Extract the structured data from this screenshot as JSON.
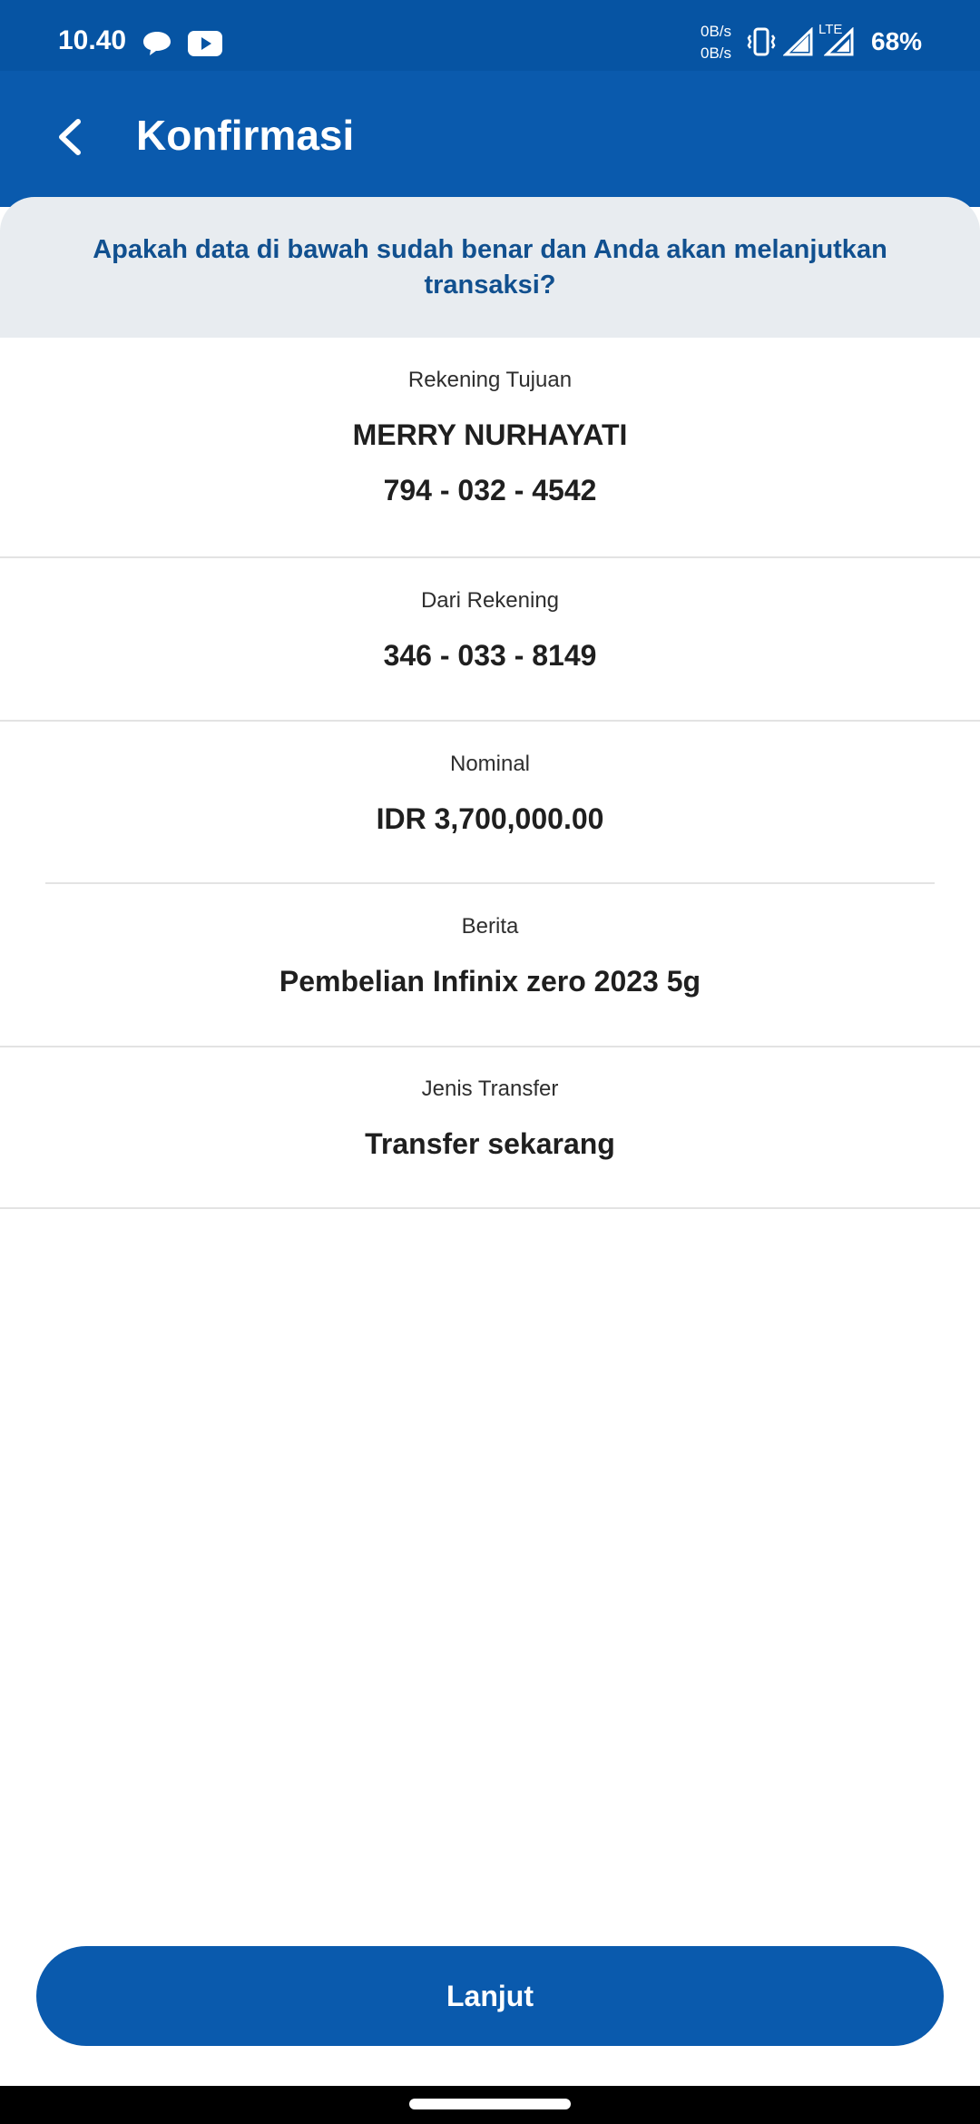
{
  "status_bar": {
    "time": "10.40",
    "net_speed_up": "0B/s",
    "net_speed_down": "0B/s",
    "network_type": "LTE",
    "battery": "68%",
    "icons": [
      "chat-bubble-icon",
      "youtube-icon",
      "vibrate-icon",
      "signal-icon",
      "signal-icon"
    ]
  },
  "header": {
    "title": "Konfirmasi",
    "back_icon": "chevron-left-icon"
  },
  "prompt": {
    "text": "Apakah data di bawah sudah benar dan Anda akan melanjutkan transaksi?"
  },
  "details": {
    "destination": {
      "label": "Rekening Tujuan",
      "name": "MERRY NURHAYATI",
      "account": "794 - 032 - 4542"
    },
    "source": {
      "label": "Dari Rekening",
      "account": "346 - 033 - 8149"
    },
    "amount": {
      "label": "Nominal",
      "value": "IDR 3,700,000.00"
    },
    "message": {
      "label": "Berita",
      "value": "Pembelian Infinix zero 2023 5g"
    },
    "transfer_type": {
      "label": "Jenis Transfer",
      "value": "Transfer sekarang"
    }
  },
  "actions": {
    "continue_label": "Lanjut"
  },
  "colors": {
    "primary": "#0a5aad",
    "status_bar": "#0654a3",
    "prompt_background": "#e8ecf0",
    "prompt_text": "#11508f"
  }
}
